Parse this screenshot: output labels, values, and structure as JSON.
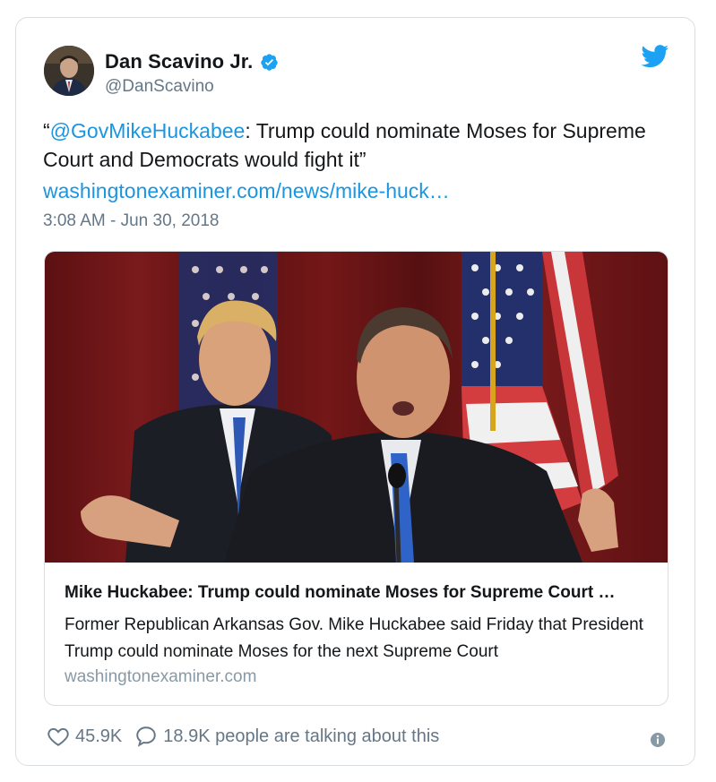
{
  "author": {
    "name": "Dan Scavino Jr.",
    "handle": "@DanScavino",
    "verified": true
  },
  "tweet": {
    "open_quote": "“",
    "mention": "@GovMikeHuckabee",
    "text_rest": ": Trump could nominate Moses for Supreme Court and Democrats would fight it”",
    "link": "washingtonexaminer.com/news/mike-huck…",
    "timestamp": "3:08 AM - Jun 30, 2018"
  },
  "card": {
    "title": "Mike Huckabee: Trump could nominate Moses for Supreme Court …",
    "description": "Former Republican Arkansas Gov. Mike Huckabee said Friday that President Trump could nominate Moses for the next Supreme Court",
    "domain": "washingtonexaminer.com"
  },
  "footer": {
    "likes": "45.9K",
    "talking": "18.9K people are talking about this"
  },
  "icons": {
    "brand": "twitter-bird-icon",
    "verified": "verified-badge-icon",
    "like": "heart-icon",
    "reply": "speech-bubble-icon",
    "info": "info-icon"
  },
  "colors": {
    "accent": "#1b95e0",
    "text": "#14171a",
    "secondary": "#657786",
    "border": "#d9dee3"
  }
}
